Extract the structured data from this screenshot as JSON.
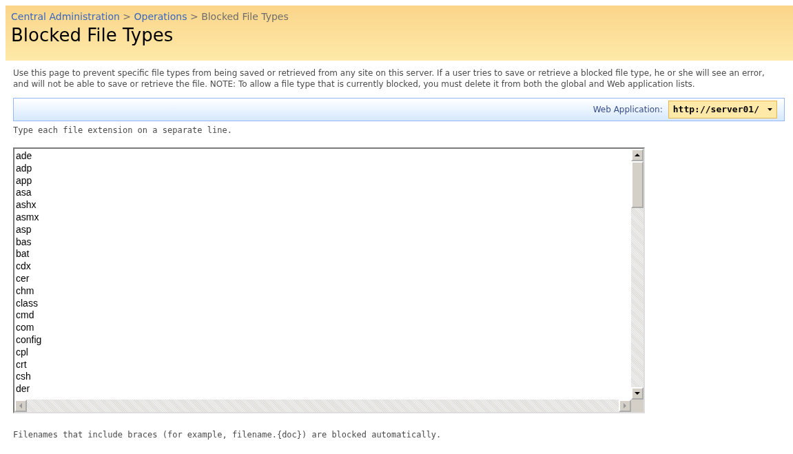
{
  "breadcrumb": [
    {
      "label": "Central Administration",
      "link": true
    },
    {
      "label": "Operations",
      "link": true
    },
    {
      "label": "Blocked File Types",
      "link": false
    }
  ],
  "breadcrumb_separators": [
    ">",
    ">"
  ],
  "page_title": "Blocked File Types",
  "description": "Use this page to prevent specific file types from being saved or retrieved from any site on this server. If a user tries to save or retrieve a blocked file type, he or she will see an error, and will not be able to save or retrieve the file. NOTE: To allow a file type that is currently blocked, you must delete it from both the global and Web application lists.",
  "web_application": {
    "label": "Web Application:",
    "value": "http://server01/"
  },
  "hint": "Type each file extension on a separate line.",
  "extensions": [
    "ade",
    "adp",
    "app",
    "asa",
    "ashx",
    "asmx",
    "asp",
    "bas",
    "bat",
    "cdx",
    "cer",
    "chm",
    "class",
    "cmd",
    "com",
    "config",
    "cpl",
    "crt",
    "csh",
    "der"
  ],
  "footer_note": "Filenames that include braces (for example, filename.{doc}) are blocked automatically."
}
